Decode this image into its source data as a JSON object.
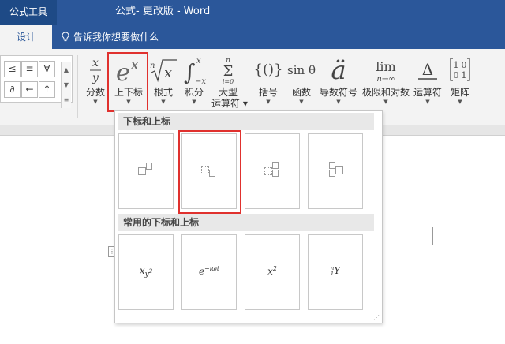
{
  "title_bar": {
    "context_tab": "公式工具",
    "doc_title": "公式- 更改版  -  Word"
  },
  "tabs": {
    "design": "设计",
    "tell_me": "告诉我你想要做什么"
  },
  "ribbon": {
    "symbols": [
      "≤",
      "≡",
      "∀",
      "∂",
      "←",
      "↑"
    ],
    "buttons": [
      {
        "id": "fraction",
        "symbol": "x/y",
        "label": "分数"
      },
      {
        "id": "script",
        "symbol": "eˣ",
        "label": "上下标"
      },
      {
        "id": "radical",
        "symbol": "ⁿ√x",
        "label": "根式"
      },
      {
        "id": "integral",
        "symbol": "∫",
        "label": "积分"
      },
      {
        "id": "large_operator",
        "symbol": "Σ",
        "label": "大型",
        "label2": "运算符"
      },
      {
        "id": "bracket",
        "symbol": "{()}",
        "label": "括号"
      },
      {
        "id": "function",
        "symbol": "sin θ",
        "label": "函数"
      },
      {
        "id": "accent",
        "symbol": "ä",
        "label": "导数符号"
      },
      {
        "id": "limit_log",
        "symbol": "lim",
        "label": "极限和对数"
      },
      {
        "id": "operator",
        "symbol": "Δ",
        "label": "运算符"
      },
      {
        "id": "matrix",
        "symbol": "[10/01]",
        "label": "矩阵"
      }
    ]
  },
  "gallery": {
    "section1_title": "下标和上标",
    "section2_title": "常用的下标和上标",
    "common": [
      "x_{y²}",
      "e^{−iωt}",
      "x²",
      "ⁿ₁Y"
    ],
    "captions": {
      "c1": "x",
      "c1_sub": "y",
      "c1_sup": "2",
      "c2": "e",
      "c2_sup": "−iωt",
      "c3": "x",
      "c3_sup": "2",
      "c4_pre_sup": "n",
      "c4_pre_sub": "1",
      "c4": "Y"
    }
  }
}
